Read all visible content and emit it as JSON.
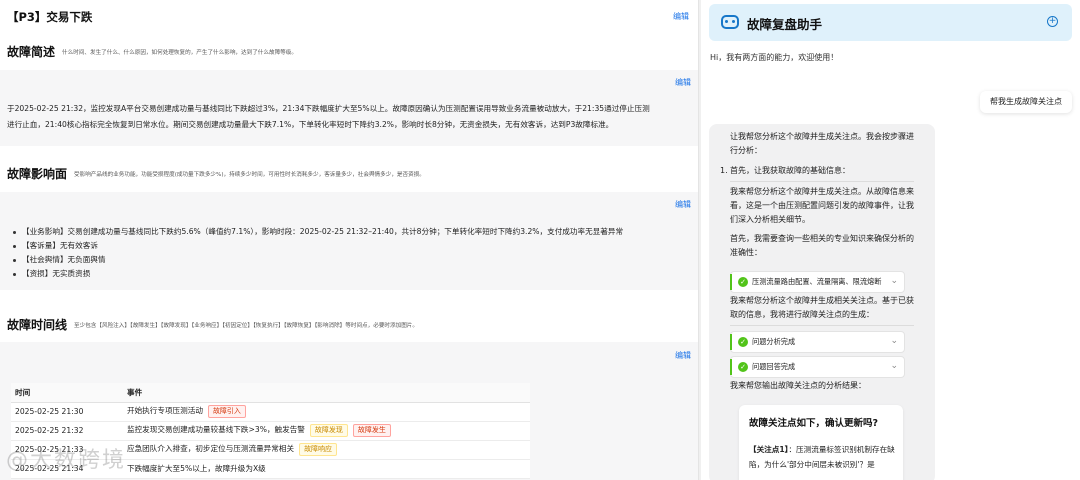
{
  "document": {
    "title": "【P3】交易下跌",
    "edit_label": "编辑",
    "summary": {
      "heading": "故障简述",
      "hint": "什么时间、发生了什么、什么原因，如何处理恢复的，产生了什么影响，达到了什么故障等级。",
      "text": "于2025-02-25 21:32，监控发现A平台交易创建成功量与基线同比下跌超过3%，21:34下跌幅度扩大至5%以上。故障原因确认为压测配置误用导致业务流量被动放大，于21:35通过停止压测进行止血，21:40核心指标完全恢复到日常水位。期间交易创建成功量最大下跌7.1%，下单转化率短时下降约3.2%，影响时长8分钟，无资金损失，无有效客诉，达到P3故障标准。"
    },
    "impact": {
      "heading": "故障影响面",
      "hint": "受影响产品线的业务功能，功能受损程度(成功量下跌多少%)，持续多少时间，可用性时长消耗多少，客诉量多少，社会舆情多少，是否资损。",
      "bullets": [
        "【业务影响】交易创建成功量与基线同比下跌约5.6%（峰值约7.1%），影响时段：2025-02-25 21:32–21:40，共计8分钟；下单转化率短时下降约3.2%，支付成功率无显著异常",
        "【客诉量】无有效客诉",
        "【社会舆情】无负面舆情",
        "【资损】无实质资损"
      ]
    },
    "timeline": {
      "heading": "故障时间线",
      "hint": "至少包含【风险注入】【故障发生】【故障发现】【业务响应】【初因定位】【恢复执行】【故障恢复】【影响消除】等时间点，必要时添加图片。",
      "columns": [
        "时间",
        "事件"
      ],
      "rows": [
        {
          "time": "2025-02-25 21:30",
          "event": "开始执行专项压测活动",
          "tags": [
            {
              "text": "故障引入",
              "color": "red"
            }
          ]
        },
        {
          "time": "2025-02-25 21:32",
          "event": "监控发现交易创建成功量较基线下跌>3%，触发告警",
          "tags": [
            {
              "text": "故障发现",
              "color": "yellow"
            },
            {
              "text": "故障发生",
              "color": "red"
            }
          ]
        },
        {
          "time": "2025-02-25 21:33",
          "event": "应急团队介入排查，初步定位与压测流量异常相关",
          "tags": [
            {
              "text": "故障响应",
              "color": "yellow"
            }
          ]
        },
        {
          "time": "2025-02-25 21:34",
          "event": "下跌幅度扩大至5%以上，故障升级为X级",
          "tags": []
        }
      ]
    },
    "watermark": "@大数跨境"
  },
  "assistant": {
    "title": "故障复盘助手",
    "add_icon": "+",
    "greeting": "Hi，我有两方面的能力，欢迎使用！",
    "user_message": "帮我生成故障关注点",
    "reply": {
      "intro": "让我帮您分析这个故障并生成关注点。我会按步骤进行分析：",
      "step1_num": "1.",
      "step1": "首先，让我获取故障的基础信息：",
      "p1": "我来帮您分析这个故障并生成关注点。从故障信息来看，这是一个由压测配置问题引发的故障事件，让我们深入分析相关细节。",
      "p2": "首先，我需要查询一些相关的专业知识来确保分析的准确性：",
      "tool1": "压测流量路由配置、流量隔离、限流熔断",
      "p3": "我来帮您分析这个故障并生成相关关注点。基于已获取的信息，我将进行故障关注点的生成：",
      "tool2": "问题分析完成",
      "tool3": "问题回答完成",
      "p4": "我来帮您输出故障关注点的分析结果：",
      "card_title": "故障关注点如下，确认更新吗?",
      "card_label": "【关注点1】",
      "card_text": "：压测流量标签识别机制存在缺陷，为什么'部分中间层未被识别'？是"
    }
  }
}
